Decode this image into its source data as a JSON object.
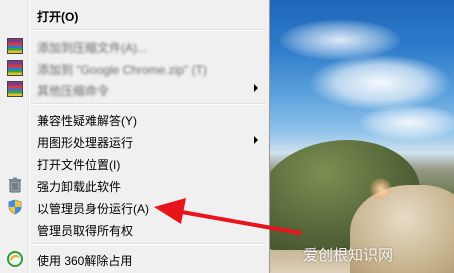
{
  "menu": {
    "items": [
      {
        "id": "open",
        "label": "打开(O)",
        "icon": ""
      },
      {
        "id": "zip1",
        "label": "添加到压缩文件(A)...",
        "icon": "archive-icon"
      },
      {
        "id": "zip2",
        "label": "添加到 \"Google Chrome.zip\" (T)",
        "icon": "archive-icon"
      },
      {
        "id": "zip3",
        "label": "其他压缩命令",
        "icon": "archive-icon"
      },
      {
        "id": "compat",
        "label": "兼容性疑难解答(Y)",
        "icon": ""
      },
      {
        "id": "gpu",
        "label": "用图形处理器运行",
        "icon": ""
      },
      {
        "id": "location",
        "label": "打开文件位置(I)",
        "icon": ""
      },
      {
        "id": "uninstall",
        "label": "强力卸载此软件",
        "icon": "trash-icon"
      },
      {
        "id": "runas",
        "label": "以管理员身份运行(A)",
        "icon": "uac-shield-icon"
      },
      {
        "id": "ownership",
        "label": "管理员取得所有权",
        "icon": ""
      },
      {
        "id": "unlock",
        "label": "使用 360解除占用",
        "icon": "360-icon"
      }
    ]
  },
  "watermark": "爱创根知识网",
  "colors": {
    "arrow": "#e8141c",
    "menu_bg": "#f0f0f0"
  }
}
